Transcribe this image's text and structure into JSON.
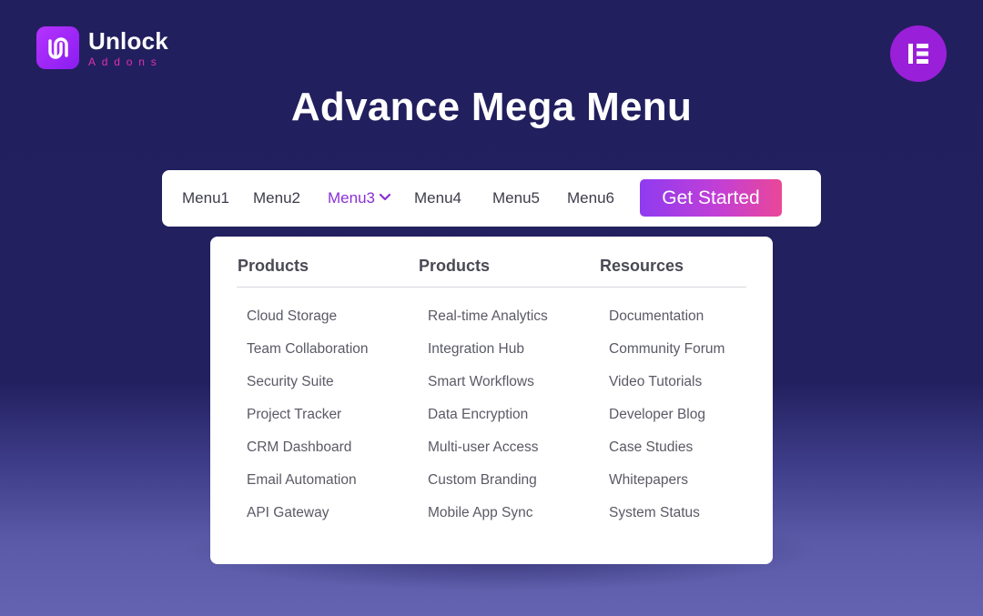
{
  "brand": {
    "name": "Unlock",
    "sub": "Addons",
    "logo_icon": "unlock-addons-logo-icon",
    "colors": {
      "mark": "#b633ff",
      "sub": "#e02fb4"
    }
  },
  "badge": {
    "icon": "elementor-icon",
    "color": "#9a1fd8"
  },
  "page_title": "Advance Mega Menu",
  "nav": {
    "items": [
      {
        "label": "Menu1",
        "active": false
      },
      {
        "label": "Menu2",
        "active": false
      },
      {
        "label": "Menu3",
        "active": true,
        "icon": "chevron-down-icon"
      },
      {
        "label": "Menu4",
        "active": false
      },
      {
        "label": "Menu5",
        "active": false
      },
      {
        "label": "Menu6",
        "active": false
      }
    ],
    "cta_label": "Get Started",
    "active_color": "#8b30d6"
  },
  "mega_menu": {
    "columns": [
      {
        "heading": "Products",
        "items": [
          "Cloud Storage",
          "Team Collaboration",
          "Security Suite",
          "Project Tracker",
          "CRM Dashboard",
          "Email Automation",
          "API Gateway"
        ]
      },
      {
        "heading": "Products",
        "items": [
          "Real-time Analytics",
          "Integration Hub",
          "Smart Workflows",
          "Data Encryption",
          "Multi-user Access",
          "Custom Branding",
          "Mobile App Sync"
        ]
      },
      {
        "heading": "Resources",
        "items": [
          "Documentation",
          "Community Forum",
          "Video Tutorials",
          "Developer Blog",
          "Case Studies",
          "Whitepapers",
          "System Status"
        ]
      }
    ]
  }
}
